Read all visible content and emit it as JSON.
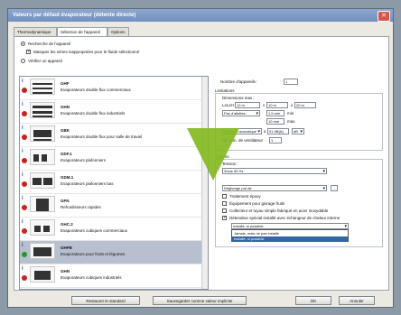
{
  "window": {
    "title": "Valeurs par défaut évaporateur (détente directe)"
  },
  "tabs": [
    "Thermodynamique",
    "Sélection de l'appareil",
    "Options"
  ],
  "left": {
    "radio_search": "Recherche de l'appareil",
    "check_mask": "Masquer les séries inappropriées pour le fluide sélectionné",
    "radio_verify": "Vérifier un appareil"
  },
  "products": [
    {
      "code": "GHF",
      "desc": "Evaporateurs double flux commerciaux",
      "status": "red",
      "icon": "double-flow-cooler-icon"
    },
    {
      "code": "GHN",
      "desc": "Evaporateurs double flux industriels",
      "status": "red",
      "icon": "double-flow-industrial-icon"
    },
    {
      "code": "GBK",
      "desc": "Evaporateurs double flux pour salle de travail",
      "status": "red",
      "icon": "workroom-cooler-icon"
    },
    {
      "code": "GDF.1",
      "desc": "Evaporateurs plafonniers",
      "status": "red",
      "icon": "ceiling-cooler-icon"
    },
    {
      "code": "GDM.1",
      "desc": "Evaporateurs plafonniers bas",
      "status": "red",
      "icon": "low-ceiling-cooler-icon"
    },
    {
      "code": "GFN",
      "desc": "Refroidisseurs rapides",
      "status": "red",
      "icon": "rapid-cooler-icon"
    },
    {
      "code": "GHC.2",
      "desc": "Evaporateurs cubiques commerciaux",
      "status": "red",
      "icon": "cubic-cooler-icon"
    },
    {
      "code": "GHFB",
      "desc": "Evaporateurs pour fruits et légumes",
      "status": "green",
      "icon": "fruit-cooler-icon"
    },
    {
      "code": "GHN",
      "desc": "Evaporateurs cubiques industriels",
      "status": "red",
      "icon": "cubic-industrial-icon"
    }
  ],
  "right": {
    "devices_label": "Nombre d'appareils :",
    "devices_value": "1",
    "limits_label": "Limitations",
    "dims_label": "Dimensions max :",
    "lxhxh_label": "LxLxH",
    "dim1": "12 m",
    "dim2": "10 m",
    "dim3": "20 m",
    "deflection_label": "Pas d'ailettes",
    "step1": "1,5 mm",
    "min_label": "min",
    "step2": "10 mm",
    "max_label": "max",
    "pressure_label": "Pression acoustique",
    "pressure_value": "91 dB(A)",
    "pressure_unit": "dB",
    "fans_label": "Nb. min. de ventilateur",
    "fans_value": "1",
    "options_label": "Options",
    "voltage_label": "Tension :",
    "voltage_value": "3/ous 50 Hz",
    "defrost_value": "Dégivrage par air",
    "opt_epoxy": "Traitement époxy",
    "opt_fruit": "Équipement pour givrage fruits",
    "opt_tube": "Collecteur et tuyau simple fabriqué en acier inoxydable",
    "opt_exchanger": "Détendeur spécial installé avec échangeur de chaleur interne",
    "dropdown_value": "Installé, si possible",
    "dropdown_options": [
      "Jamais, mais ne pas installé",
      "Installé, si possible"
    ]
  },
  "buttons": {
    "restore": "Restaurer le standard",
    "save_default": "Sauvegarder comme valeur implicite",
    "ok": "OK",
    "cancel": "Annuler"
  },
  "colors": {
    "status_red": "#d0201c",
    "status_green": "#1e9a2a",
    "arrow": "#84b91f",
    "selection": "#b8bfce"
  }
}
